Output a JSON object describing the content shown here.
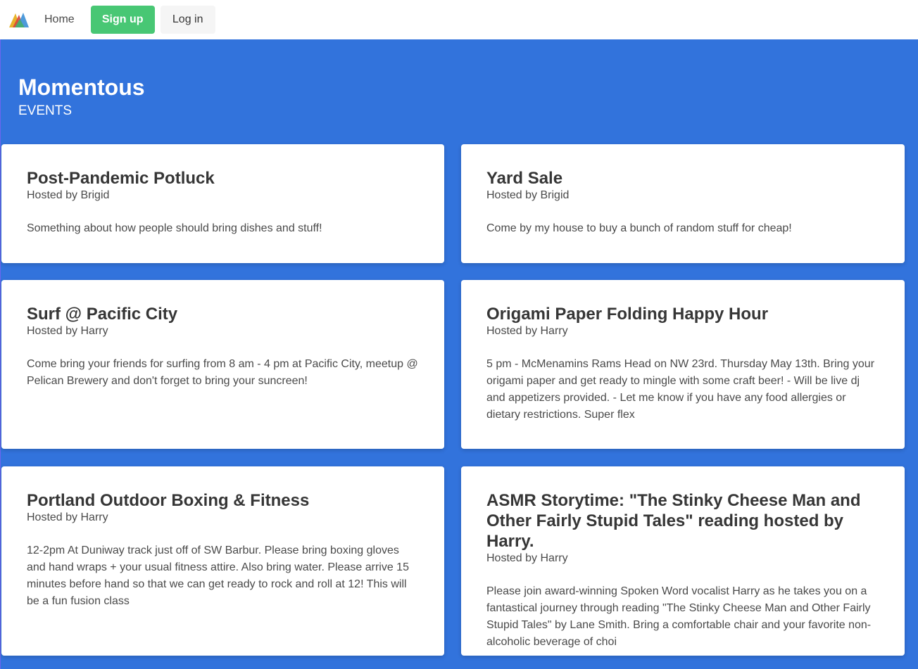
{
  "nav": {
    "logo_icon": "momentous-mountain-logo-icon",
    "home_label": "Home",
    "signup_label": "Sign up",
    "login_label": "Log in"
  },
  "hero": {
    "title": "Momentous",
    "subtitle": "EVENTS"
  },
  "colors": {
    "hero_background": "#3273dc",
    "signup_button": "#48c774",
    "login_button": "#f5f5f5",
    "card_background": "#ffffff"
  },
  "events": [
    {
      "title": "Post-Pandemic Potluck",
      "host": "Hosted by Brigid",
      "description": "Something about how people should bring dishes and stuff!"
    },
    {
      "title": "Yard Sale",
      "host": "Hosted by Brigid",
      "description": "Come by my house to buy a bunch of random stuff for cheap!"
    },
    {
      "title": "Surf @ Pacific City",
      "host": "Hosted by Harry",
      "description": "Come bring your friends for surfing from 8 am - 4 pm at Pacific City, meetup @ Pelican Brewery and don't forget to bring your suncreen!"
    },
    {
      "title": "Origami Paper Folding Happy Hour",
      "host": "Hosted by Harry",
      "description": "5 pm - McMenamins Rams Head on NW 23rd. Thursday May 13th. Bring your origami paper and get ready to mingle with some craft beer! - Will be live dj and appetizers provided. - Let me know if you have any food allergies or dietary restrictions. Super flex"
    },
    {
      "title": "Portland Outdoor Boxing & Fitness",
      "host": "Hosted by Harry",
      "description": "12-2pm At Duniway track just off of SW Barbur. Please bring boxing gloves and hand wraps + your usual fitness attire. Also bring water. Please arrive 15 minutes before hand so that we can get ready to rock and roll at 12! This will be a fun fusion class"
    },
    {
      "title": "ASMR Storytime: \"The Stinky Cheese Man and Other Fairly Stupid Tales\" reading hosted by Harry.",
      "host": "Hosted by Harry",
      "description": "Please join award-winning Spoken Word vocalist Harry as he takes you on a fantastical journey through reading \"The Stinky Cheese Man and Other Fairly Stupid Tales\" by Lane Smith. Bring a comfortable chair and your favorite non-alcoholic beverage of choi"
    }
  ]
}
